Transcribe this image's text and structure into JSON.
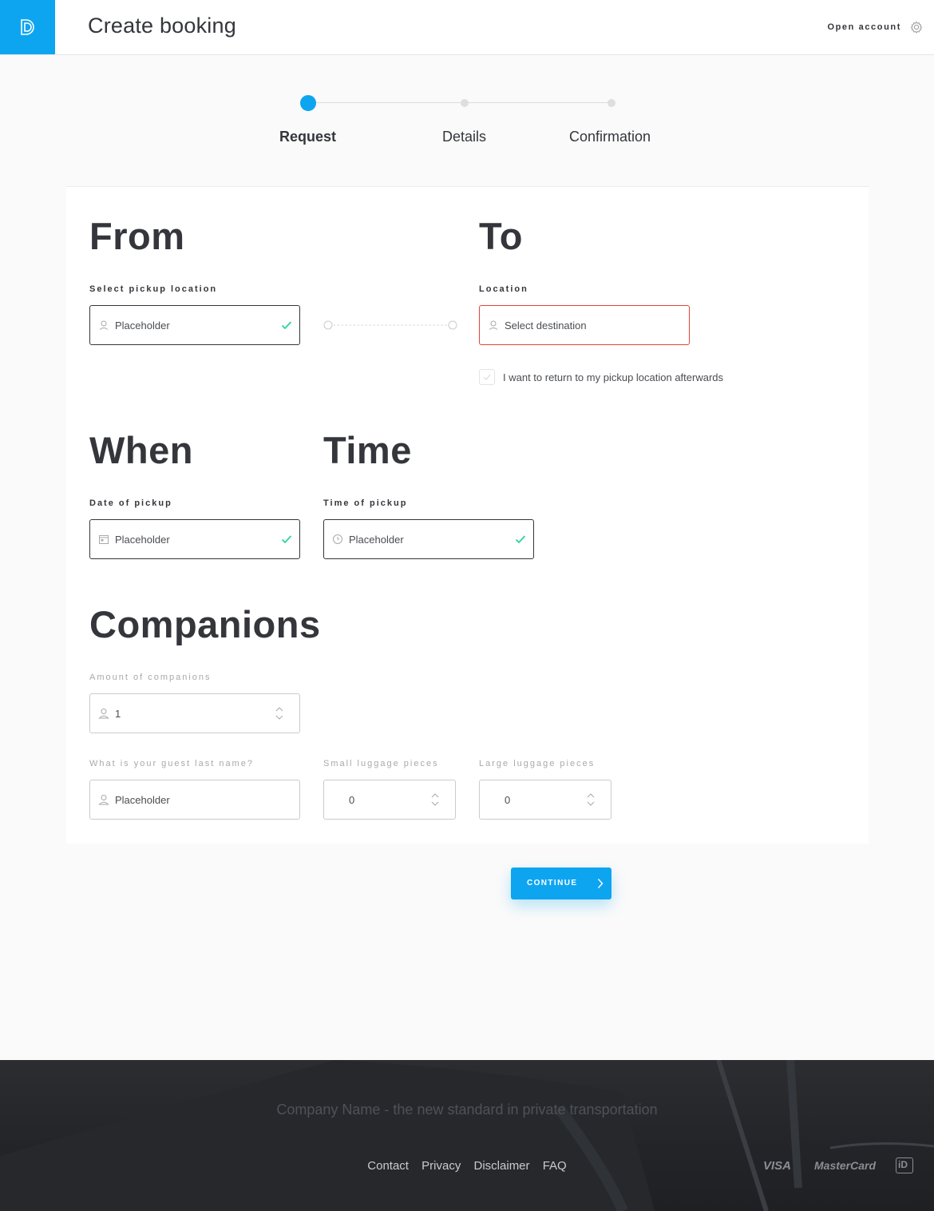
{
  "header": {
    "title": "Create booking",
    "open_account": "Open account"
  },
  "stepper": {
    "steps": [
      {
        "label": "Request",
        "active": true
      },
      {
        "label": "Details",
        "active": false
      },
      {
        "label": "Confirmation",
        "active": false
      }
    ],
    "active_color": "#0ea5f0"
  },
  "from": {
    "heading": "From",
    "label": "Select pickup location",
    "value": "Placeholder"
  },
  "to": {
    "heading": "To",
    "label": "Location",
    "value": "Select destination",
    "error_color": "#e2443b"
  },
  "return_trip": {
    "label": "I want to return to my pickup location afterwards",
    "checked": false
  },
  "when": {
    "heading": "When",
    "label": "Date of pickup",
    "value": "Placeholder"
  },
  "time": {
    "heading": "Time",
    "label": "Time of pickup",
    "value": "Placeholder"
  },
  "companions": {
    "heading": "Companions",
    "amount_label": "Amount of companions",
    "amount_value": "1",
    "guest_label": "What is your guest last name?",
    "guest_value": "Placeholder",
    "small_luggage_label": "Small luggage pieces",
    "small_luggage_value": "0",
    "large_luggage_label": "Large luggage pieces",
    "large_luggage_value": "0"
  },
  "continue_button": {
    "label": "CONTINUE"
  },
  "footer": {
    "tagline": "Company Name - the new standard in private transportation",
    "links": [
      "Contact",
      "Privacy",
      "Disclaimer",
      "FAQ"
    ],
    "payment": [
      "VISA",
      "MasterCard",
      "iD"
    ]
  },
  "colors": {
    "accent": "#0ea5f0",
    "valid": "#2bd4a3",
    "error": "#e2443b",
    "text": "#34363b"
  }
}
